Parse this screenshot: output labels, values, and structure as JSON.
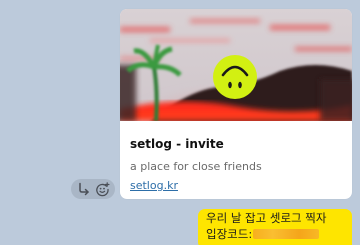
{
  "link_preview": {
    "title": "setlog - invite",
    "description": "a place for close friends",
    "domain": "setlog.kr",
    "image_icon": "upside-down-smile-face"
  },
  "actions": [
    {
      "name": "share-icon"
    },
    {
      "name": "add-reaction-icon"
    }
  ],
  "message": {
    "line1": "우리 날 잡고 셋로그 찍자",
    "line2_prefix": "입장코드:",
    "line2_code_hidden": true
  },
  "colors": {
    "chat_background": "#bccadb",
    "bubble": "#fee500",
    "link": "#2d6ea8",
    "smiley": "#d2f012"
  }
}
